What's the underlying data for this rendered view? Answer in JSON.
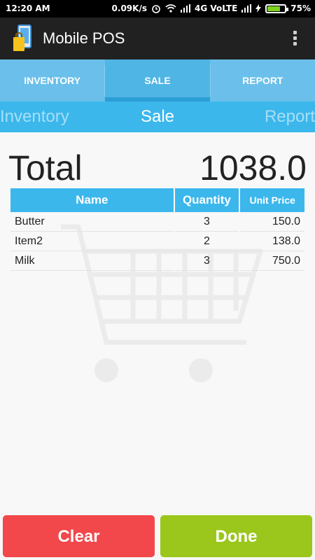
{
  "status_bar": {
    "time": "12:20 AM",
    "net_speed": "0.09K/s",
    "network": "4G VoLTE",
    "battery": "75%",
    "battery_level": 0.75
  },
  "app_bar": {
    "title": "Mobile POS"
  },
  "tabs": [
    {
      "label": "INVENTORY",
      "active": false
    },
    {
      "label": "SALE",
      "active": true
    },
    {
      "label": "REPORT",
      "active": false
    }
  ],
  "pager": {
    "left": "Inventory",
    "center": "Sale",
    "right": "Report"
  },
  "summary": {
    "total_label": "Total",
    "total_value": "1038.0"
  },
  "table": {
    "headers": [
      "Name",
      "Quantity",
      "Unit Price"
    ],
    "rows": [
      {
        "name": "Butter",
        "qty": "3",
        "price": "150.0"
      },
      {
        "name": "Item2",
        "qty": "2",
        "price": "138.0"
      },
      {
        "name": "Milk",
        "qty": "3",
        "price": "750.0"
      }
    ]
  },
  "actions": {
    "clear": "Clear",
    "done": "Done"
  },
  "colors": {
    "accent": "#3bb7ec",
    "tab_bg": "#6ac0ea",
    "clear": "#f2474b",
    "done": "#9bc71c",
    "app_bar": "#212121"
  }
}
